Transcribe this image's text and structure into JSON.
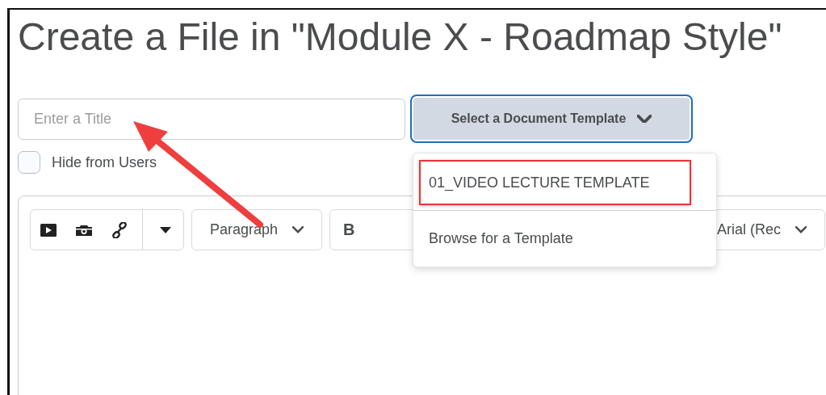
{
  "page_title": "Create a File in \"Module X - Roadmap Style\"",
  "title_field": {
    "placeholder": "Enter a Title"
  },
  "template_button": {
    "label": "Select a Document Template",
    "expanded": true
  },
  "template_menu": [
    {
      "label": "01_VIDEO LECTURE TEMPLATE",
      "highlighted": true
    },
    {
      "label": "Browse for a Template",
      "highlighted": false
    }
  ],
  "hide_from_users": {
    "label": "Hide from Users",
    "checked": false
  },
  "toolbar": {
    "format_select": "Paragraph",
    "bold": "B",
    "font_select": "Arial (Rec"
  }
}
